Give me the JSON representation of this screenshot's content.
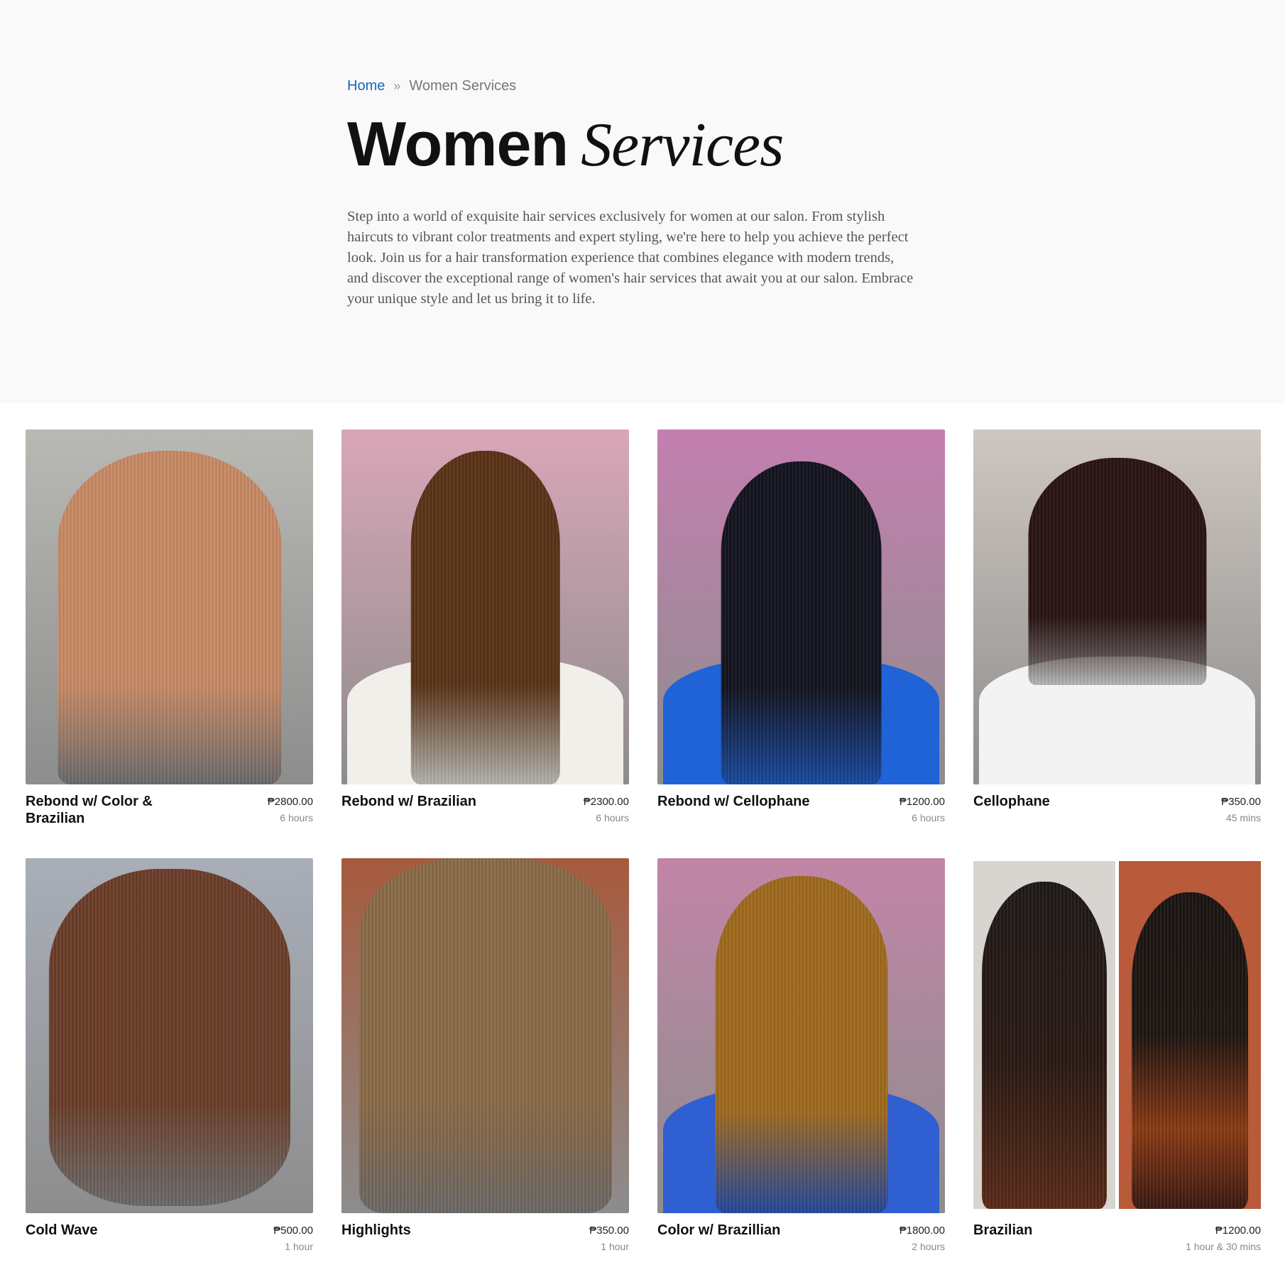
{
  "breadcrumb": {
    "home": "Home",
    "separator": "»",
    "current": "Women Services"
  },
  "page_title": {
    "bold": "Women",
    "italic": "Services"
  },
  "intro": "Step into a world of exquisite hair services exclusively for women at our salon. From stylish haircuts to vibrant color treatments and expert styling, we're here to help you achieve the perfect look. Join us for a hair transformation experience that combines elegance with modern trends, and discover the exceptional range of women's hair services that await you at our salon. Embrace your unique style and let us bring it to life.",
  "services": [
    {
      "name": "Rebond w/ Color & Brazilian",
      "price": "₱2800.00",
      "duration": "6 hours",
      "hair_color": "#c98a66",
      "bg_color": "#b9b9b4",
      "cape_color": "#2a2a2a"
    },
    {
      "name": "Rebond w/ Brazilian",
      "price": "₱2300.00",
      "duration": "6 hours",
      "hair_color": "#5a3318",
      "bg_color": "#d9a6b8",
      "cape_color": "#f1efe9"
    },
    {
      "name": "Rebond w/ Cellophane",
      "price": "₱1200.00",
      "duration": "6 hours",
      "hair_color": "#14141f",
      "bg_color": "#c47fb0",
      "cape_color": "#1f63d6"
    },
    {
      "name": "Cellophane",
      "price": "₱350.00",
      "duration": "45 mins",
      "hair_color": "#2a1414",
      "bg_color": "#cfc7c0",
      "cape_color": "#f3f3f3"
    },
    {
      "name": "Cold Wave",
      "price": "₱500.00",
      "duration": "1 hour",
      "hair_color": "#6b3f2a",
      "bg_color": "#a9aeb8",
      "cape_color": "#f6f6f6"
    },
    {
      "name": "Highlights",
      "price": "₱350.00",
      "duration": "1 hour",
      "hair_color": "#8a6b48",
      "bg_color": "#a65a3c",
      "cape_color": "#444444"
    },
    {
      "name": "Color w/ Brazillian",
      "price": "₱1800.00",
      "duration": "2 hours",
      "hair_color": "#a06a1e",
      "bg_color": "#c285a7",
      "cape_color": "#2f5fd0"
    },
    {
      "name": "Brazilian",
      "price": "₱1200.00",
      "duration": "1 hour & 30 mins",
      "hair_color": "#2a1a14",
      "bg_color": "#d8d5d0",
      "cape_color": "#6b2a12"
    }
  ]
}
